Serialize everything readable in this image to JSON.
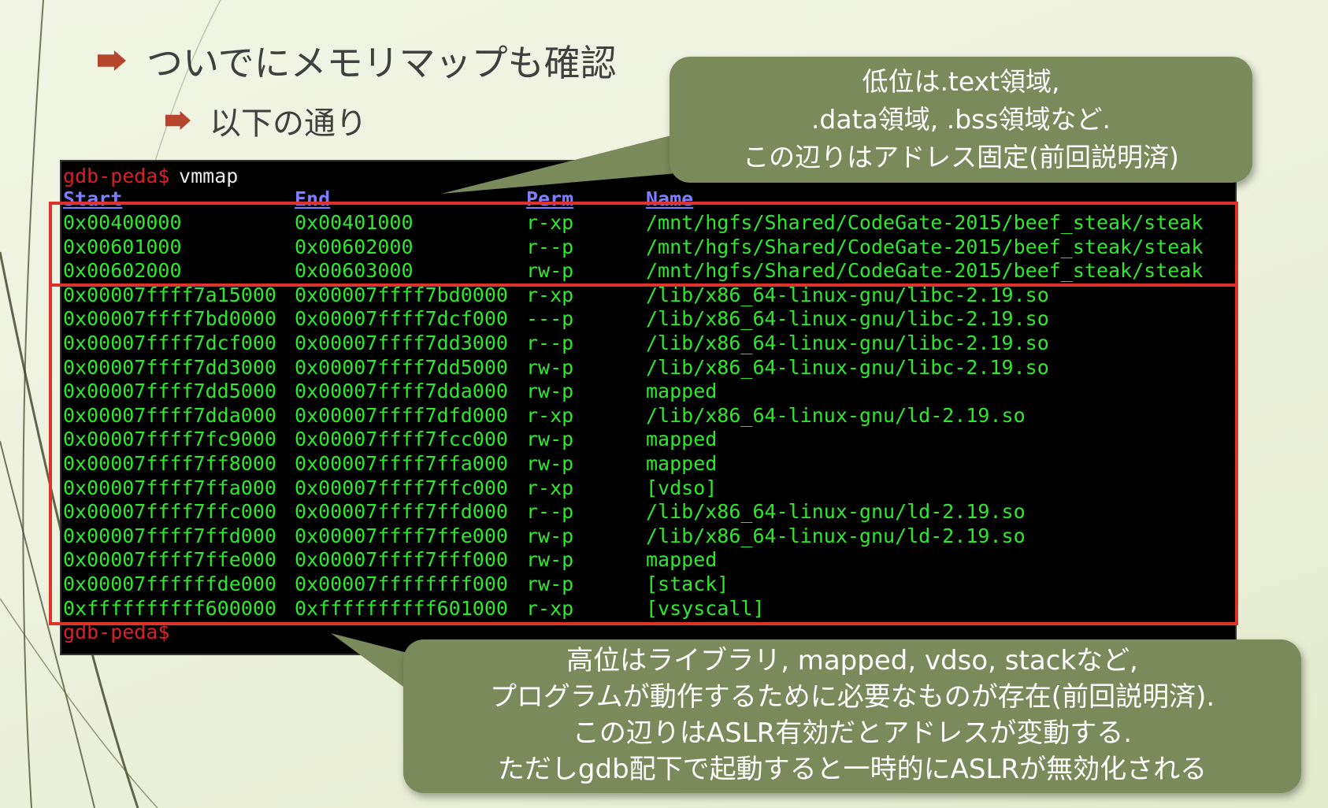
{
  "slide": {
    "bullet1": "ついでにメモリマップも確認",
    "bullet2": "以下の通り"
  },
  "terminal": {
    "prompt": "gdb-peda$",
    "command": " vmmap",
    "headers": [
      "Start",
      "End",
      "Perm",
      "Name"
    ],
    "rows": [
      [
        "0x00400000",
        "0x00401000",
        "r-xp",
        "/mnt/hgfs/Shared/CodeGate-2015/beef_steak/steak"
      ],
      [
        "0x00601000",
        "0x00602000",
        "r--p",
        "/mnt/hgfs/Shared/CodeGate-2015/beef_steak/steak"
      ],
      [
        "0x00602000",
        "0x00603000",
        "rw-p",
        "/mnt/hgfs/Shared/CodeGate-2015/beef_steak/steak"
      ],
      [
        "0x00007ffff7a15000",
        "0x00007ffff7bd0000",
        "r-xp",
        "/lib/x86_64-linux-gnu/libc-2.19.so"
      ],
      [
        "0x00007ffff7bd0000",
        "0x00007ffff7dcf000",
        "---p",
        "/lib/x86_64-linux-gnu/libc-2.19.so"
      ],
      [
        "0x00007ffff7dcf000",
        "0x00007ffff7dd3000",
        "r--p",
        "/lib/x86_64-linux-gnu/libc-2.19.so"
      ],
      [
        "0x00007ffff7dd3000",
        "0x00007ffff7dd5000",
        "rw-p",
        "/lib/x86_64-linux-gnu/libc-2.19.so"
      ],
      [
        "0x00007ffff7dd5000",
        "0x00007ffff7dda000",
        "rw-p",
        "mapped"
      ],
      [
        "0x00007ffff7dda000",
        "0x00007ffff7dfd000",
        "r-xp",
        "/lib/x86_64-linux-gnu/ld-2.19.so"
      ],
      [
        "0x00007ffff7fc9000",
        "0x00007ffff7fcc000",
        "rw-p",
        "mapped"
      ],
      [
        "0x00007ffff7ff8000",
        "0x00007ffff7ffa000",
        "rw-p",
        "mapped"
      ],
      [
        "0x00007ffff7ffa000",
        "0x00007ffff7ffc000",
        "r-xp",
        "[vdso]"
      ],
      [
        "0x00007ffff7ffc000",
        "0x00007ffff7ffd000",
        "r--p",
        "/lib/x86_64-linux-gnu/ld-2.19.so"
      ],
      [
        "0x00007ffff7ffd000",
        "0x00007ffff7ffe000",
        "rw-p",
        "/lib/x86_64-linux-gnu/ld-2.19.so"
      ],
      [
        "0x00007ffff7ffe000",
        "0x00007ffff7fff000",
        "rw-p",
        "mapped"
      ],
      [
        "0x00007ffffffde000",
        "0x00007ffffffff000",
        "rw-p",
        "[stack]"
      ],
      [
        "0xffffffffff600000",
        "0xffffffffff601000",
        "r-xp",
        "[vsyscall]"
      ]
    ]
  },
  "callout_top": {
    "lines": [
      "低位は.text領域,",
      ".data領域, .bss領域など.",
      "この辺りはアドレス固定(前回説明済)"
    ]
  },
  "callout_bottom": {
    "lines": [
      "高位はライブラリ, mapped, vdso, stackなど,",
      "プログラムが動作するために必要なものが存在(前回説明済).",
      "この辺りはASLR有効だとアドレスが変動する.",
      "ただしgdb配下で起動すると一時的にASLRが無効化される"
    ]
  },
  "colors": {
    "bubble": "#7a8a5b",
    "highlight_box": "#e0322d",
    "terminal_text": "#2ee82e",
    "bullet_arrow": "#b5452b"
  }
}
